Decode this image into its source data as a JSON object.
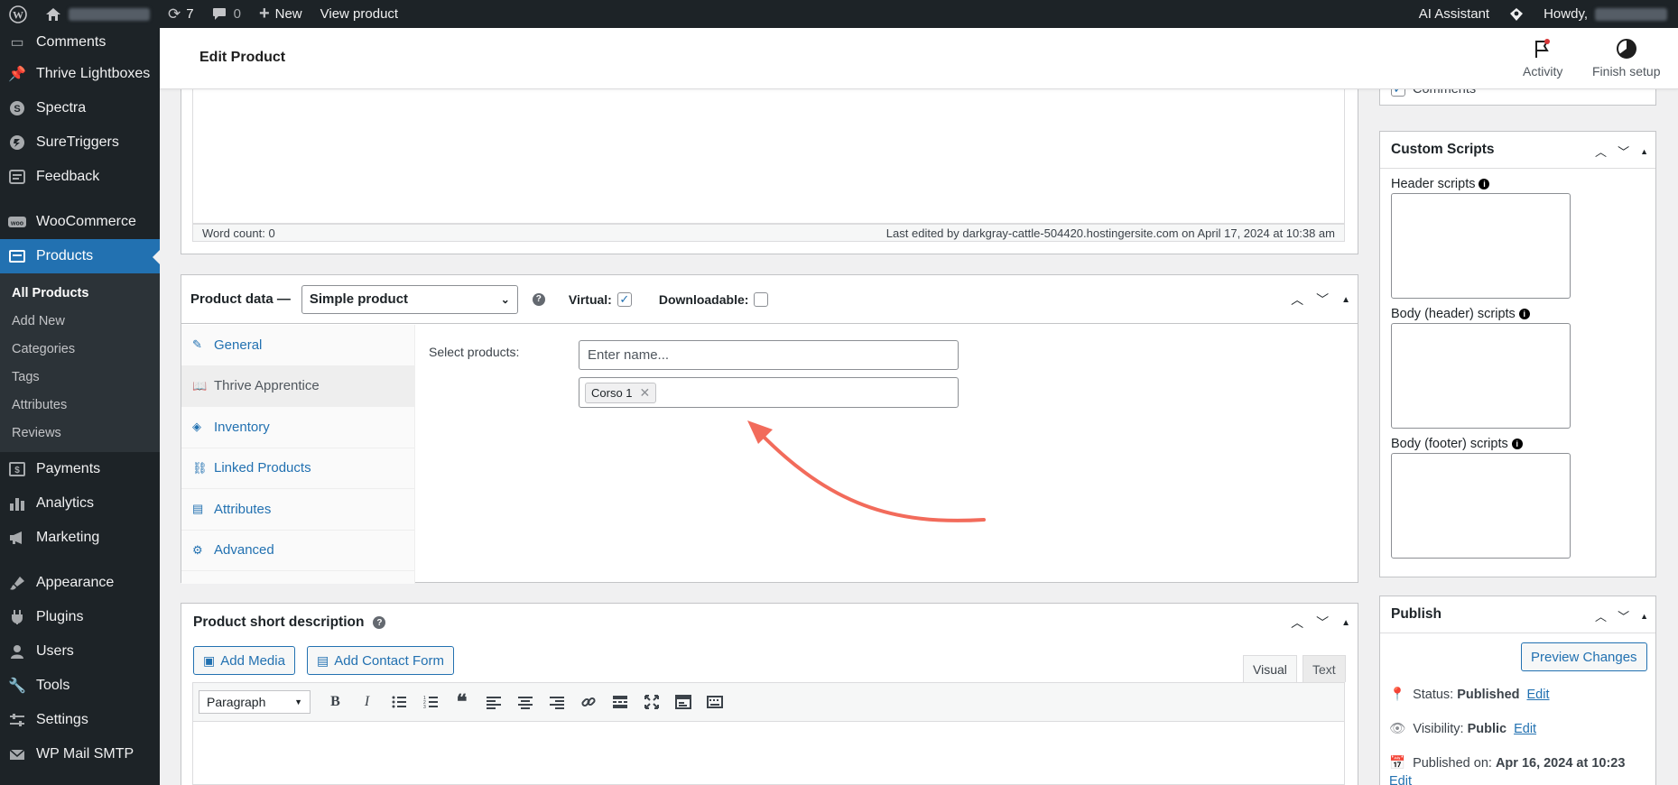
{
  "adminbar": {
    "updates_count": "7",
    "comments_count": "0",
    "new_label": "New",
    "view_product_label": "View product",
    "ai_assistant_label": "AI Assistant",
    "howdy_label": "Howdy,"
  },
  "sidebar": {
    "items_top": [
      {
        "label": "Comments",
        "icon": "comment-icon"
      },
      {
        "label": "Thrive Lightboxes",
        "icon": "pin-icon"
      },
      {
        "label": "Spectra",
        "icon": "spectra-icon"
      },
      {
        "label": "SureTriggers",
        "icon": "suretriggers-icon"
      },
      {
        "label": "Feedback",
        "icon": "feedback-icon"
      }
    ],
    "woocommerce": "WooCommerce",
    "products": "Products",
    "submenu": [
      "All Products",
      "Add New",
      "Categories",
      "Tags",
      "Attributes",
      "Reviews"
    ],
    "items_mid": [
      {
        "label": "Payments",
        "icon": "payments-icon"
      },
      {
        "label": "Analytics",
        "icon": "analytics-icon"
      },
      {
        "label": "Marketing",
        "icon": "megaphone-icon"
      }
    ],
    "items_bottom": [
      {
        "label": "Appearance",
        "icon": "brush-icon"
      },
      {
        "label": "Plugins",
        "icon": "plugin-icon"
      },
      {
        "label": "Users",
        "icon": "users-icon"
      },
      {
        "label": "Tools",
        "icon": "wrench-icon"
      },
      {
        "label": "Settings",
        "icon": "settings-icon"
      },
      {
        "label": "WP Mail SMTP",
        "icon": "mail-icon"
      }
    ]
  },
  "header": {
    "title": "Edit Product",
    "activity_label": "Activity",
    "finish_setup_label": "Finish setup"
  },
  "editor": {
    "word_count": "Word count: 0",
    "last_edited": "Last edited by darkgray-cattle-504420.hostingersite.com on April 17, 2024 at 10:38 am"
  },
  "product_data": {
    "title": "Product data —",
    "type_selected": "Simple product",
    "virtual_label": "Virtual:",
    "virtual_checked": true,
    "downloadable_label": "Downloadable:",
    "downloadable_checked": false,
    "tabs": [
      "General",
      "Thrive Apprentice",
      "Inventory",
      "Linked Products",
      "Attributes",
      "Advanced"
    ],
    "active_tab": "Thrive Apprentice",
    "select_products_label": "Select products:",
    "search_placeholder": "Enter name...",
    "selected_token": "Corso 1"
  },
  "short_description": {
    "title": "Product short description",
    "add_media_label": "Add Media",
    "add_contact_form_label": "Add Contact Form",
    "visual_tab": "Visual",
    "text_tab": "Text",
    "format_selected": "Paragraph"
  },
  "right": {
    "comments_label": "Comments",
    "custom_scripts_title": "Custom Scripts",
    "header_scripts_label": "Header scripts",
    "body_header_scripts_label": "Body (header) scripts",
    "body_footer_scripts_label": "Body (footer) scripts",
    "publish_title": "Publish",
    "preview_changes_label": "Preview Changes",
    "status_label": "Status:",
    "status_value": "Published",
    "visibility_label": "Visibility:",
    "visibility_value": "Public",
    "published_on_label": "Published on:",
    "published_on_value": "Apr 16, 2024 at 10:23",
    "edit_label": "Edit"
  },
  "colors": {
    "accent": "#2271b1",
    "admin_dark": "#1d2327",
    "annotation_arrow": "#f26b5b"
  }
}
